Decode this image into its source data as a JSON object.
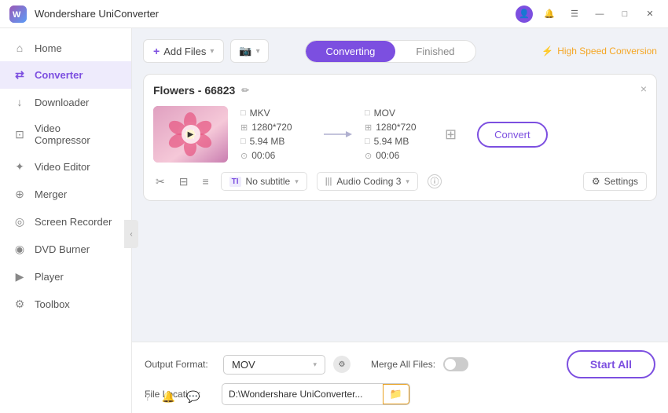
{
  "titleBar": {
    "appName": "Wondershare UniConverter",
    "logoColor": "#7c4fe0"
  },
  "sidebar": {
    "items": [
      {
        "id": "home",
        "label": "Home",
        "icon": "⌂",
        "active": false
      },
      {
        "id": "converter",
        "label": "Converter",
        "icon": "⇄",
        "active": true
      },
      {
        "id": "downloader",
        "label": "Downloader",
        "icon": "↓",
        "active": false
      },
      {
        "id": "video-compressor",
        "label": "Video Compressor",
        "icon": "⊡",
        "active": false
      },
      {
        "id": "video-editor",
        "label": "Video Editor",
        "icon": "✂",
        "active": false
      },
      {
        "id": "merger",
        "label": "Merger",
        "icon": "⊕",
        "active": false
      },
      {
        "id": "screen-recorder",
        "label": "Screen Recorder",
        "icon": "◎",
        "active": false
      },
      {
        "id": "dvd-burner",
        "label": "DVD Burner",
        "icon": "◉",
        "active": false
      },
      {
        "id": "player",
        "label": "Player",
        "icon": "▶",
        "active": false
      },
      {
        "id": "toolbox",
        "label": "Toolbox",
        "icon": "⚙",
        "active": false
      }
    ]
  },
  "header": {
    "addFilesLabel": "Add Files",
    "convertingLabel": "Converting",
    "finishedLabel": "Finished",
    "speedLabel": "High Speed Conversion"
  },
  "fileCard": {
    "name": "Flowers - 66823",
    "closeBtn": "×",
    "source": {
      "format": "MKV",
      "resolution": "1280*720",
      "size": "5.94 MB",
      "duration": "00:06"
    },
    "output": {
      "format": "MOV",
      "resolution": "1280*720",
      "size": "5.94 MB",
      "duration": "00:06"
    },
    "convertBtnLabel": "Convert",
    "actions": {
      "cutIcon": "✂",
      "bookmarkIcon": "⊟",
      "menuIcon": "≡"
    },
    "subtitle": {
      "label": "No subtitle",
      "icon": "TI"
    },
    "audio": {
      "label": "Audio Coding 3",
      "icon": "|||"
    },
    "settingsLabel": "Settings"
  },
  "bottomBar": {
    "outputFormatLabel": "Output Format:",
    "outputFormatValue": "MOV",
    "fileLocationLabel": "File Location:",
    "fileLocationValue": "D:\\Wondershare UniConverter...",
    "mergeLabel": "Merge All Files:",
    "startAllLabel": "Start All"
  },
  "colors": {
    "accent": "#7c4fe0",
    "orange": "#f5a623",
    "folderBtnBorder": "#e8a020"
  }
}
